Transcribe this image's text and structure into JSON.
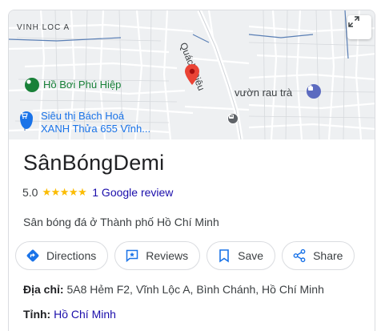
{
  "map": {
    "labels": {
      "area": "VINH LOC A",
      "street": "Quách Điêu"
    },
    "places": {
      "pool": "Hồ Bơi Phú Hiệp",
      "market": "vườn rau trà",
      "supermarket_line1": "Siêu thị Bách Hoá",
      "supermarket_line2": "XANH Thửa 655 Vĩnh..."
    },
    "icons": {
      "pin": "red-location-pin-icon",
      "expand": "expand-arrows-icon",
      "bus": "bus-stop-icon",
      "cart": "shopping-cart-icon",
      "poi": "green-poi-icon"
    },
    "colors": {
      "pin": "#ea4335",
      "place_green": "#188038",
      "place_blue": "#1a73e8",
      "road_blue": "#4a6fa5"
    }
  },
  "business": {
    "name": "SânBóngDemi",
    "rating": "5.0",
    "stars": "★★★★★",
    "review_link": "1 Google review",
    "category": "Sân bóng đá ở Thành phố Hồ Chí Minh"
  },
  "actions": [
    {
      "label": "Directions",
      "icon": "directions-icon"
    },
    {
      "label": "Reviews",
      "icon": "reviews-icon"
    },
    {
      "label": "Save",
      "icon": "bookmark-icon"
    },
    {
      "label": "Share",
      "icon": "share-icon"
    }
  ],
  "details": {
    "address_label": "Địa chỉ",
    "address_value": "5A8 Hẻm F2, Vĩnh Lộc A, Bình Chánh, Hồ Chí Minh",
    "province_label": "Tỉnh",
    "province_value": "Hồ Chí Minh"
  },
  "colors": {
    "star": "#fbbc04",
    "link": "#1a0dab",
    "accent": "#1a73e8"
  }
}
